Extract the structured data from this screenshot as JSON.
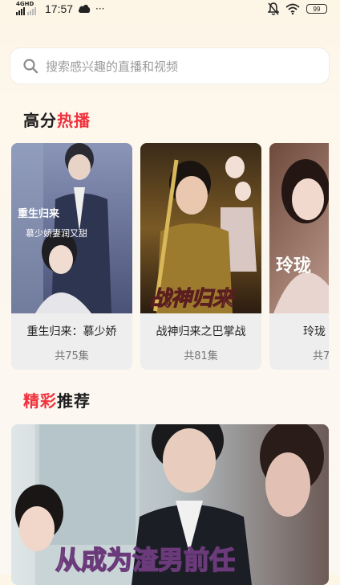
{
  "status_bar": {
    "network": "4GHD",
    "time": "17:57",
    "more": "···",
    "battery": "99"
  },
  "search": {
    "placeholder": "搜索感兴趣的直播和视频",
    "icon": "search-icon"
  },
  "hot_section": {
    "title_a": "高分",
    "title_b": "热播",
    "cards": [
      {
        "title": "重生归来：慕少娇",
        "episodes": "共75集",
        "poster_text": "重生归来",
        "poster_sub": "慕少娇妻润又甜"
      },
      {
        "title": "战神归来之巴掌战",
        "episodes": "共81集",
        "poster_text": "战神归来"
      },
      {
        "title": "玲珑",
        "episodes": "共7",
        "poster_text": "玲珑"
      }
    ]
  },
  "recommend_section": {
    "title_a": "精彩",
    "title_b": "推荐",
    "banner_text": "从成为渣男前任"
  },
  "colors": {
    "accent": "#f0313d",
    "card_bg": "#eeeeee",
    "page_bg": "#fdf6e6"
  }
}
